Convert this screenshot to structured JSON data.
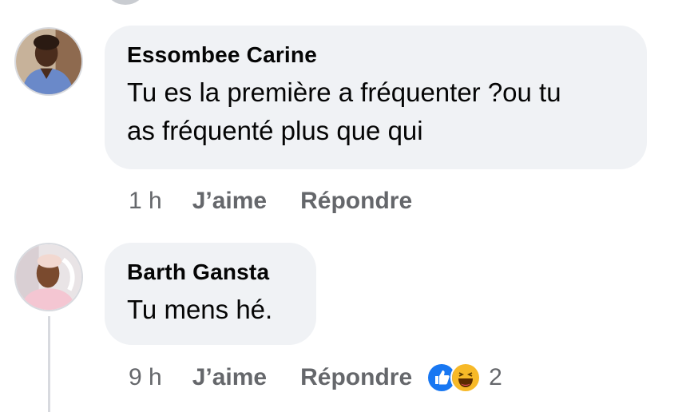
{
  "comments": [
    {
      "author": "Essombee Carine",
      "text_lines": [
        "Tu es la première a fréquenter ?ou tu",
        "as fréquenté plus que qui"
      ],
      "time": "1 h",
      "like_label": "J’aime",
      "reply_label": "Répondre"
    },
    {
      "author": "Barth Gansta",
      "text_lines": [
        "Tu mens hé."
      ],
      "time": "9 h",
      "like_label": "J’aime",
      "reply_label": "Répondre",
      "reactions": {
        "icons": [
          "like-reaction-icon",
          "haha-reaction-icon"
        ],
        "count": "2"
      }
    }
  ],
  "colors": {
    "bubble": "#f0f2f5",
    "meta_text": "#65676b",
    "like_blue": "#1877f2",
    "haha_yellow": "#f7b928"
  }
}
